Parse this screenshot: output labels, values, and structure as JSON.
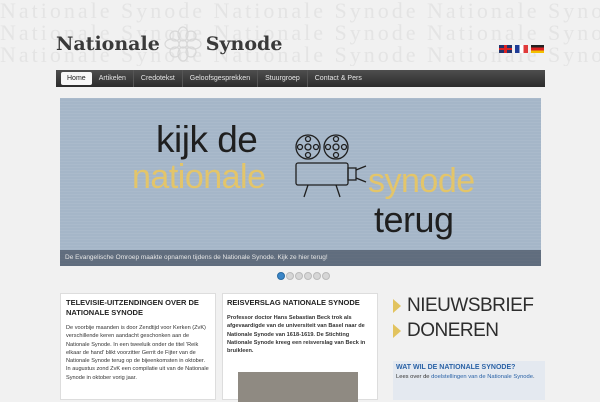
{
  "site": {
    "logo_left": "Nationale",
    "logo_right": "Synode",
    "bg_text": "Nationale Synode Nationale Synode Nationale Synode"
  },
  "languages": [
    "English",
    "Français",
    "Deutsch"
  ],
  "nav": {
    "items": [
      "Home",
      "Artikelen",
      "Credotekst",
      "Geloofsgesprekken",
      "Stuurgroep",
      "Contact & Pers"
    ]
  },
  "slider": {
    "line1": "kijk de",
    "line2a": "nationale",
    "line2b": "synode",
    "line3": "terug",
    "caption": "De Evangelische Omroep maakte opnamen tijdens de Nationale Synode. Kijk ze hier terug!",
    "slide_count": 6,
    "active_slide": 1
  },
  "article1": {
    "title": "TELEVISIE-UITZENDINGEN OVER DE NATIONALE SYNODE",
    "body": "De voorbije maanden is door Zendtijd voor Kerken (ZvK) verschillende keren aandacht geschonken aan de Nationale Synode. In een tweeluik onder de titel 'Reik elkaar de hand' blikt voorzitter Gerrit de Fijter van de Nationale Synode terug op de bijeenkomsten in oktober. In augustus zond ZvK een compilatie uit van de Nationale Synode in oktober vorig jaar."
  },
  "article2": {
    "title": "REISVERSLAG NATIONALE SYNODE",
    "body": "Professor doctor Hans Sebastian Beck trok als afgevaardigde van de universiteit van Basel naar de Nationale Synode van 1618-1619. De Stichting Nationale Synode kreeg een reisverslag van Beck in bruikleen."
  },
  "sidebar": {
    "promo1": "NIEUWSBRIEF",
    "promo2": "DONEREN",
    "info_title": "WAT WIL DE NATIONALE SYNODE?",
    "info_prefix": "Lees over de ",
    "info_link": "doelstellingen van de Nationale Synode",
    "info_suffix": "."
  },
  "colors": {
    "nav_bg": "#3a3a3a",
    "slider_bg": "#a5b6c8",
    "accent_gold": "#e3c56a",
    "link_blue": "#2a62a6"
  }
}
